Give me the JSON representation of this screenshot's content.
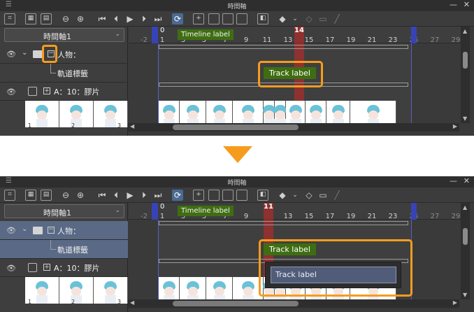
{
  "colors": {
    "accent_orange": "#f59c1e",
    "label_green": "#3f6e12",
    "playhead_red": "#d02626",
    "frame_blue": "#3743b6",
    "selection": "#5a6a86"
  },
  "panels": [
    {
      "title": "時間軸",
      "timeline_select": "時間軸1",
      "folder_name": "人物：",
      "label_track_name": "軌道標籤",
      "cel_track_name": "A：10：膠片",
      "timeline_label": "Timeline label",
      "track_label": "Track label",
      "start_frame": "0",
      "start_frame_sub": "1",
      "playhead_frame": "14",
      "ruler_numbers": [
        "-2",
        "1",
        "3",
        "5",
        "7",
        "9",
        "11",
        "13",
        "15",
        "17",
        "19",
        "21",
        "23",
        "25",
        "27",
        "29"
      ],
      "thumb_numbers": [
        "1",
        "2",
        "3"
      ],
      "edit_value": ""
    },
    {
      "title": "時間軸",
      "timeline_select": "時間軸1",
      "folder_name": "人物：",
      "label_track_name": "軌道標籤",
      "cel_track_name": "A：10：膠片",
      "timeline_label": "Timeline label",
      "track_label": "Track label",
      "start_frame": "0",
      "start_frame_sub": "1",
      "playhead_frame": "11",
      "ruler_numbers": [
        "-2",
        "1",
        "3",
        "5",
        "7",
        "9",
        "11",
        "13",
        "15",
        "17",
        "19",
        "21",
        "23",
        "25",
        "27",
        "29"
      ],
      "thumb_numbers": [
        "1",
        "2",
        "3"
      ],
      "edit_value": "Track label"
    }
  ],
  "toolbar_icons": [
    "new-timeline-icon",
    "frame-list-icon",
    "add-frame-icon",
    "zoom-out-icon",
    "zoom-in-icon",
    "first-frame-icon",
    "prev-frame-icon",
    "play-icon",
    "next-frame-icon",
    "last-frame-icon",
    "loop-icon",
    "new-cel-icon",
    "copy-cel-icon",
    "paste-cel-icon",
    "delete-cel-icon",
    "onion-skin-icon",
    "label-icon",
    "dropdown-icon",
    "label-add-icon",
    "label-edit-icon",
    "label-delete-icon"
  ]
}
